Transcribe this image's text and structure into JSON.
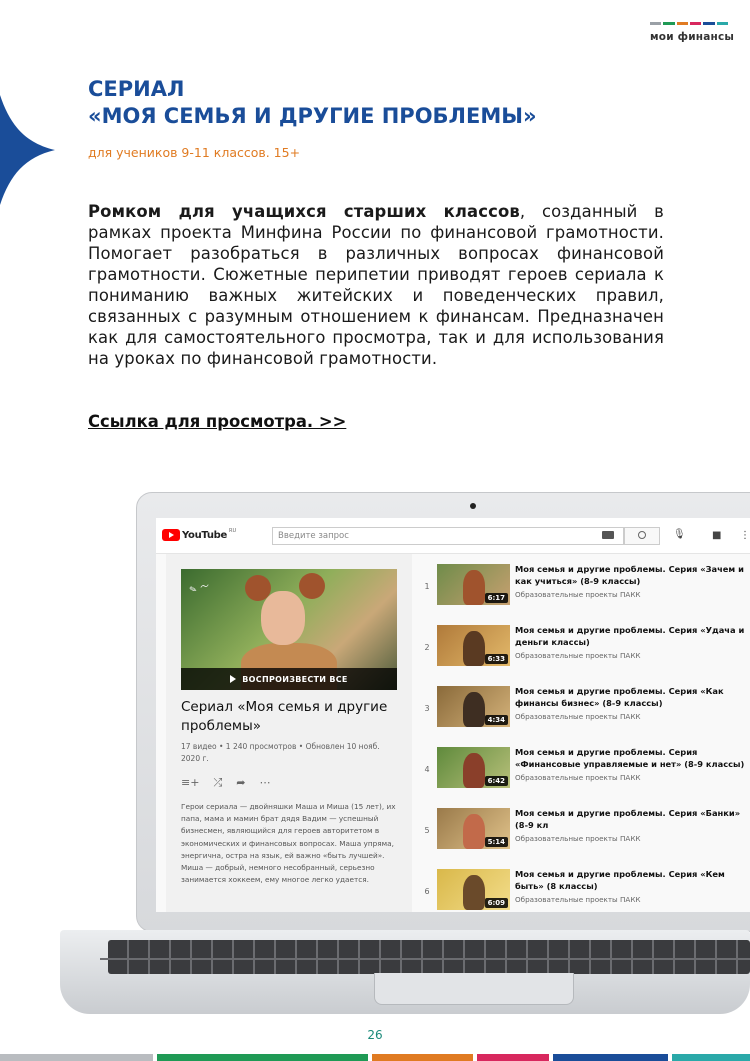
{
  "brand": {
    "logo_text": "мои финансы",
    "colors": [
      "#9aa0a6",
      "#1f9a55",
      "#e07b22",
      "#d8285e",
      "#1a4d99",
      "#2aa9a9"
    ]
  },
  "header": {
    "title_line1": "СЕРИАЛ",
    "title_line2": "«МОЯ СЕМЬЯ И ДРУГИЕ ПРОБЛЕМЫ»",
    "subtitle": "для учеников 9-11 классов. 15+"
  },
  "body": {
    "bold_lead": "Ромком для учащихся старших классов",
    "text": ", созданный в рамках проекта Минфина России по финансовой грамотности. Помогает разобраться в различных вопросах финансовой грамотности. Сюжетные перипетии приводят героев сериала к пониманию важных житейских и поведенческих правил, связанных с разумным отношением к финансам. Предназначен как для самостоятельного просмотра, так и для использования на уроках по финансовой грамотности.",
    "link": "Ссылка для просмотра. >>"
  },
  "youtube": {
    "logo": "YouTube",
    "region": "RU",
    "search_placeholder": "Введите запрос",
    "playlist": {
      "play_all": "ВОСПРОИЗВЕСТИ ВСЕ",
      "title": "Сериал «Моя семья и другие проблемы»",
      "stats": "17 видео • 1 240 просмотров • Обновлен 10 нояб. 2020 г.",
      "description": "Герои сериала — двойняшки Маша и Миша (15 лет), их папа, мама и мамин брат дядя Вадим — успешный бизнесмен, являющийся для героев авторитетом в экономических и финансовых вопросах. Маша упряма, энергична, остра на язык, ей важно «быть лучшей». Миша — добрый, немного несобранный, серьезно занимается хоккеем, ему многое легко удается."
    },
    "videos": [
      {
        "num": "1",
        "title": "Моя семья и другие проблемы. Серия «Зачем и как учиться» (8-9 классы)",
        "channel": "Образовательные проекты ПАКК",
        "duration": "6:17"
      },
      {
        "num": "2",
        "title": "Моя семья и другие проблемы. Серия «Удача и деньги классы)",
        "channel": "Образовательные проекты ПАКК",
        "duration": "6:33"
      },
      {
        "num": "3",
        "title": "Моя семья и другие проблемы. Серия «Как финансы бизнес» (8-9 классы)",
        "channel": "Образовательные проекты ПАКК",
        "duration": "4:34"
      },
      {
        "num": "4",
        "title": "Моя семья и другие проблемы. Серия «Финансовые управляемые и нет» (8-9 классы)",
        "channel": "Образовательные проекты ПАКК",
        "duration": "6:42"
      },
      {
        "num": "5",
        "title": "Моя семья и другие проблемы. Серия «Банки» (8-9 кл",
        "channel": "Образовательные проекты ПАКК",
        "duration": "5:14"
      },
      {
        "num": "6",
        "title": "Моя семья и другие проблемы. Серия «Кем быть» (8 классы)",
        "channel": "Образовательные проекты ПАКК",
        "duration": "6:09"
      }
    ]
  },
  "footer": {
    "page_number": "26"
  }
}
